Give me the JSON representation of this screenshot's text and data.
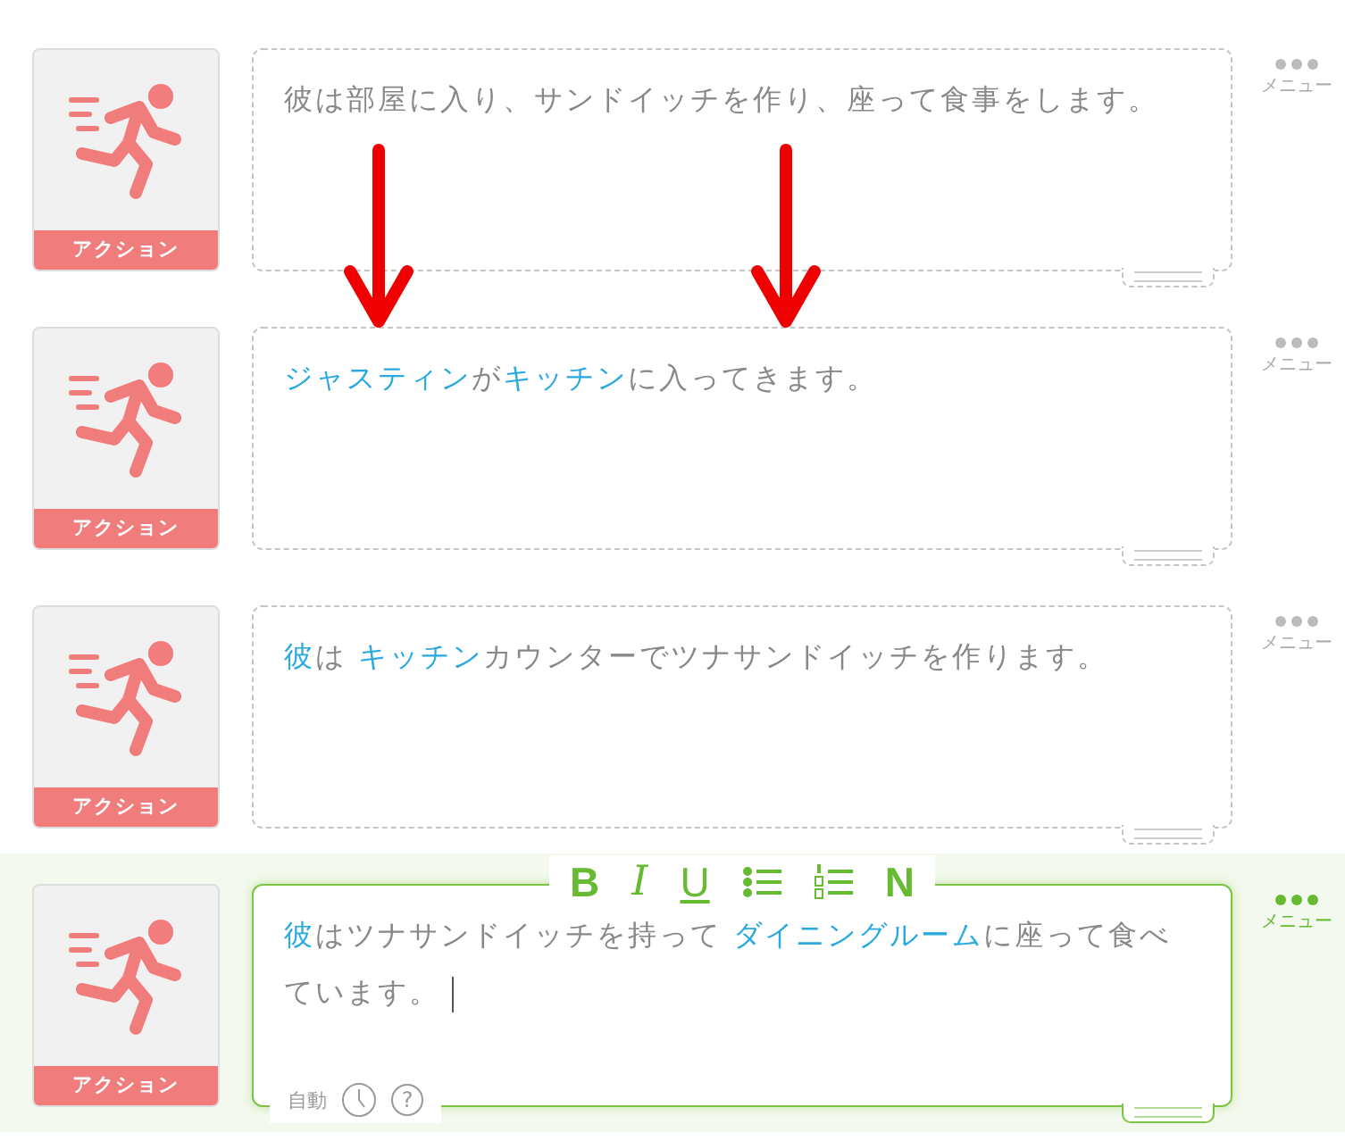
{
  "blocks": [
    {
      "category": "アクション",
      "selected": false,
      "menu_label": "メニュー",
      "segments": [
        {
          "text": "彼は部屋に入り、サンドイッチを作り、座って食事をします。",
          "highlighted": false
        }
      ]
    },
    {
      "category": "アクション",
      "selected": false,
      "menu_label": "メニュー",
      "segments": [
        {
          "text": "ジャスティン",
          "highlighted": true
        },
        {
          "text": "が",
          "highlighted": false
        },
        {
          "text": "キッチン",
          "highlighted": true
        },
        {
          "text": "に入ってきます。",
          "highlighted": false
        }
      ]
    },
    {
      "category": "アクション",
      "selected": false,
      "menu_label": "メニュー",
      "segments": [
        {
          "text": "彼",
          "highlighted": true
        },
        {
          "text": "は ",
          "highlighted": false
        },
        {
          "text": "キッチン",
          "highlighted": true
        },
        {
          "text": "カウンターでツナサンドイッチを作ります。",
          "highlighted": false
        }
      ]
    },
    {
      "category": "アクション",
      "selected": true,
      "menu_label": "メニュー",
      "segments": [
        {
          "text": "彼",
          "highlighted": true
        },
        {
          "text": "はツナサンドイッチを持って ",
          "highlighted": false
        },
        {
          "text": "ダイニングルーム",
          "highlighted": true
        },
        {
          "text": "に座って食べています。",
          "highlighted": false
        }
      ]
    }
  ],
  "toolbar": [
    {
      "kind": "bold",
      "label": "B"
    },
    {
      "kind": "italic",
      "label": "I"
    },
    {
      "kind": "underline",
      "label": "U"
    },
    {
      "kind": "bullets"
    },
    {
      "kind": "numbers"
    },
    {
      "kind": "normal",
      "label": "N"
    }
  ],
  "footer": {
    "mode_label": "自動",
    "help": "?"
  }
}
